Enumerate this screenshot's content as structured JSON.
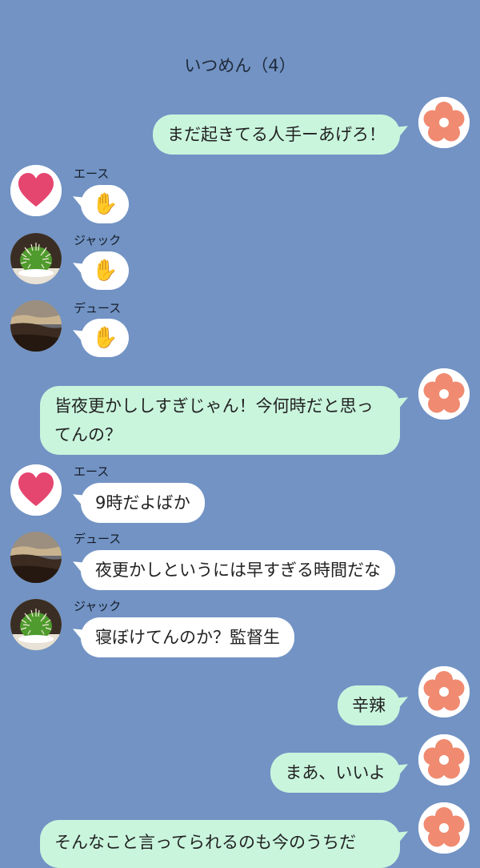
{
  "header": {
    "title": "いつめん（4）"
  },
  "messages": [
    {
      "side": "mine",
      "text": "まだ起きてる人手ーあげろ！"
    },
    {
      "side": "theirs",
      "sender": "エース",
      "avatar": "heart-icon",
      "text": "✋"
    },
    {
      "side": "theirs",
      "sender": "ジャック",
      "avatar": "cactus-icon",
      "text": "✋"
    },
    {
      "side": "theirs",
      "sender": "デュース",
      "avatar": "landscape-icon",
      "text": "✋"
    },
    {
      "side": "mine",
      "text": "皆夜更かししすぎじゃん！今何時だと思ってんの？"
    },
    {
      "side": "theirs",
      "sender": "エース",
      "avatar": "heart-icon",
      "text": "9時だよばか"
    },
    {
      "side": "theirs",
      "sender": "デュース",
      "avatar": "landscape-icon",
      "text": "夜更かしというには早すぎる時間だな"
    },
    {
      "side": "theirs",
      "sender": "ジャック",
      "avatar": "cactus-icon",
      "text": "寝ぼけてんのか？監督生"
    },
    {
      "side": "mine",
      "text": "辛辣"
    },
    {
      "side": "mine",
      "text": "まあ、いいよ"
    },
    {
      "side": "mine",
      "text": "そんなこと言ってられるのも今のうちだ"
    }
  ],
  "colors": {
    "background": "#7293c4",
    "mine_bubble": "#c9f5dd",
    "theirs_bubble": "#ffffff",
    "flower": "#f08a70",
    "heart": "#e5466f"
  }
}
